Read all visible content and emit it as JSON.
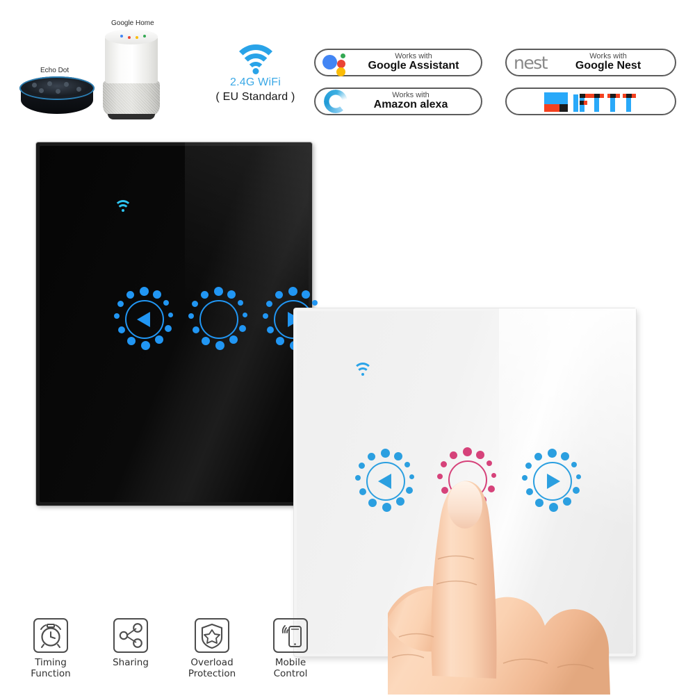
{
  "page": {
    "title": "Smart WiFi Touch Wall Switch Product Banner",
    "background": "#ffffff"
  },
  "speakers": [
    {
      "name": "echo-dot",
      "label": "Echo Dot",
      "icon": "amazon-echo-dot-device"
    },
    {
      "name": "google-home",
      "label": "Google Home",
      "icon": "google-home-speaker-device"
    }
  ],
  "wifi_block": {
    "icon": "wifi-signal-icon",
    "icon_color": "#29a3e8",
    "title": "2.4G WiFi",
    "title_color": "#3aa8e6",
    "standard": "( EU Standard )",
    "standard_color": "#151515"
  },
  "badges": [
    {
      "id": "google-assistant",
      "logo": "google-assistant-dots-icon",
      "works_with": "Works with",
      "brand": "Google Assistant",
      "colors": [
        "#4285F4",
        "#34A853",
        "#EA4335",
        "#FBBC05"
      ]
    },
    {
      "id": "amazon-alexa",
      "logo": "amazon-alexa-ring-icon",
      "works_with": "Works with",
      "brand": "Amazon alexa",
      "colors": [
        "#2fa3dd"
      ]
    },
    {
      "id": "google-nest",
      "logo": "nest",
      "works_with": "Works with",
      "brand": "Google Nest",
      "colors": [
        "#888888"
      ]
    },
    {
      "id": "ifttt",
      "logo": "ifttt-blocks-icon",
      "works_with": "",
      "brand": "",
      "colors": [
        "#29A9F9",
        "#F4411F",
        "#1c1c1c"
      ]
    }
  ],
  "panels": [
    {
      "id": "panel-black",
      "name": "black-glass-touch-switch-panel",
      "finish": "black-tempered-glass",
      "color": "#0a0a0a",
      "wifi_indicator": {
        "icon": "wifi-indicator-icon",
        "color": "#2ec4f0"
      },
      "buttons": [
        {
          "name": "curtain-open-button",
          "glyph": "triangle-left",
          "color": "#2196f3",
          "state": "on"
        },
        {
          "name": "curtain-stop-button",
          "glyph": "circle",
          "color": "#2196f3",
          "state": "on"
        },
        {
          "name": "curtain-close-button",
          "glyph": "triangle-right",
          "color": "#2196f3",
          "state": "on"
        }
      ]
    },
    {
      "id": "panel-white",
      "name": "white-glass-touch-switch-panel",
      "finish": "white-tempered-glass",
      "color": "#f4f4f4",
      "wifi_indicator": {
        "icon": "wifi-indicator-icon",
        "color": "#29a3e8"
      },
      "buttons": [
        {
          "name": "curtain-open-button",
          "glyph": "triangle-left",
          "color": "#2b9fe0",
          "state": "on"
        },
        {
          "name": "curtain-stop-button",
          "glyph": "circle",
          "color": "#d6427a",
          "state": "pressed"
        },
        {
          "name": "curtain-close-button",
          "glyph": "triangle-right",
          "color": "#2b9fe0",
          "state": "on"
        }
      ]
    }
  ],
  "hand": {
    "name": "pointing-hand-illustration",
    "gesture": "index-finger-pressing-center-button",
    "skin_color": "#f7c9a8"
  },
  "features": [
    {
      "id": "timing",
      "icon": "alarm-clock-icon",
      "line1": "Timing",
      "line2": "Function"
    },
    {
      "id": "sharing",
      "icon": "share-nodes-icon",
      "line1": "Sharing",
      "line2": ""
    },
    {
      "id": "overload",
      "icon": "shield-star-icon",
      "line1": "Overload",
      "line2": "Protection"
    },
    {
      "id": "mobile",
      "icon": "phone-signal-icon",
      "line1": "Mobile",
      "line2": "Control"
    }
  ]
}
